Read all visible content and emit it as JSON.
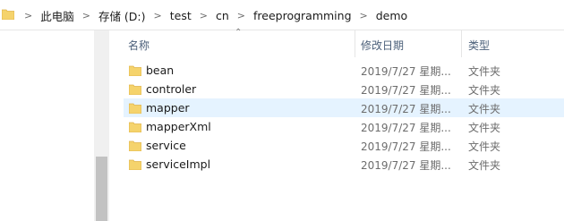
{
  "breadcrumb": [
    "此电脑",
    "存储 (D:)",
    "test",
    "cn",
    "freeprogramming",
    "demo"
  ],
  "columns": {
    "name": "名称",
    "date": "修改日期",
    "type": "类型"
  },
  "rows": [
    {
      "name": "bean",
      "date": "2019/7/27 星期...",
      "type": "文件夹"
    },
    {
      "name": "controler",
      "date": "2019/7/27 星期...",
      "type": "文件夹"
    },
    {
      "name": "mapper",
      "date": "2019/7/27 星期...",
      "type": "文件夹"
    },
    {
      "name": "mapperXml",
      "date": "2019/7/27 星期...",
      "type": "文件夹"
    },
    {
      "name": "service",
      "date": "2019/7/27 星期...",
      "type": "文件夹"
    },
    {
      "name": "serviceImpl",
      "date": "2019/7/27 星期...",
      "type": "文件夹"
    }
  ],
  "selected_row": 2,
  "colors": {
    "folder": "#f5d36c",
    "selection": "#e5f3ff",
    "header_text": "#4c607a"
  },
  "icons": {
    "folder": "folder-icon",
    "separator": "chevron-right-icon",
    "sort": "sort-up-icon"
  }
}
